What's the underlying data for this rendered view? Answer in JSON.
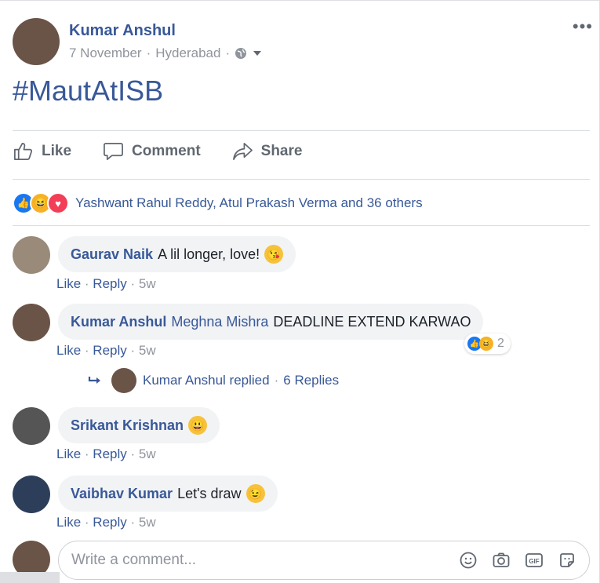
{
  "post": {
    "author": "Kumar Anshul",
    "date": "7 November",
    "location": "Hyderabad",
    "hashtag": "#MautAtISB"
  },
  "actions": {
    "like": "Like",
    "comment": "Comment",
    "share": "Share"
  },
  "reactions": {
    "names": "Yashwant Rahul Reddy, Atul Prakash Verma and 36 others"
  },
  "comments": [
    {
      "name": "Gaurav Naik",
      "text": "A lil longer, love!",
      "emoji": "kissing-face",
      "like": "Like",
      "reply": "Reply",
      "time": "5w"
    },
    {
      "name": "Kumar Anshul",
      "mention": "Meghna Mishra",
      "text": "DEADLINE EXTEND KARWAO",
      "like": "Like",
      "reply": "Reply",
      "time": "5w",
      "reaction_count": "2"
    },
    {
      "name": "Srikant Krishnan",
      "text": "",
      "emoji": "grinning-face",
      "like": "Like",
      "reply": "Reply",
      "time": "5w"
    },
    {
      "name": "Vaibhav Kumar",
      "text": "Let's draw",
      "emoji": "winking-face",
      "like": "Like",
      "reply": "Reply",
      "time": "5w"
    }
  ],
  "replies": {
    "text": "Kumar Anshul replied",
    "count": "6 Replies"
  },
  "composer": {
    "placeholder": "Write a comment..."
  },
  "colors": {
    "link": "#385898",
    "muted": "#90949c",
    "like_blue": "#1877f2",
    "love_red": "#f33e58",
    "haha_yellow": "#f7b125"
  }
}
